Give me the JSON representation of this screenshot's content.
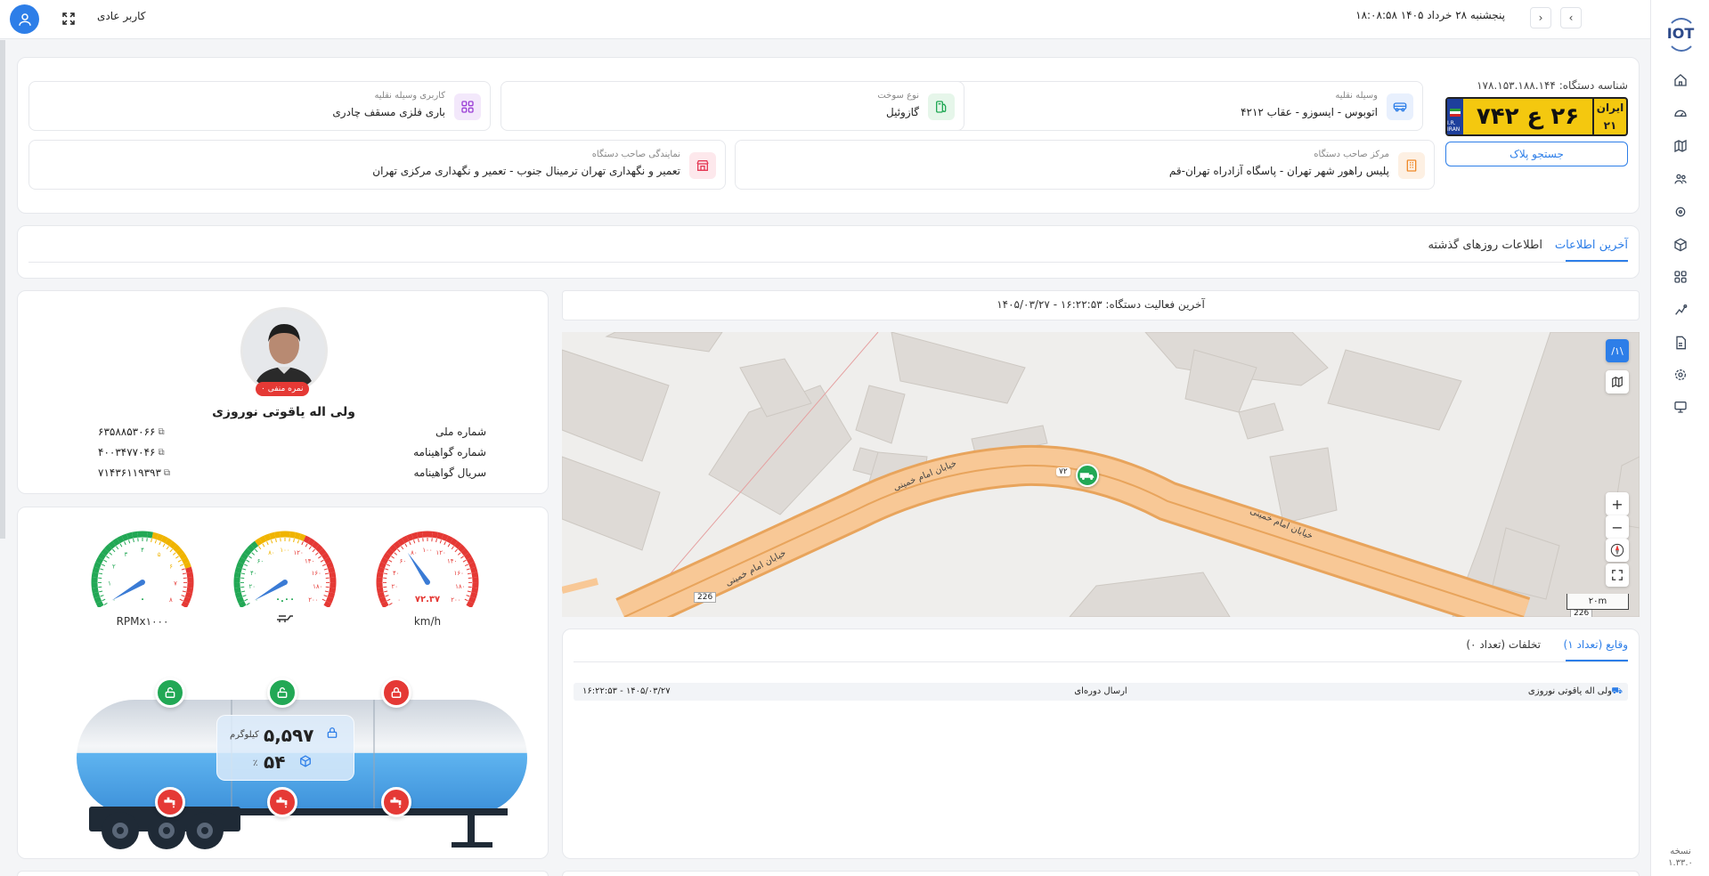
{
  "header": {
    "user_role": "کاربر عادی",
    "datetime": "پنجشنبه ۲۸ خرداد ۱۴۰۵ ۱۸:۰۸:۵۸",
    "prev_label": "‹",
    "next_label": "›"
  },
  "sidebar": {
    "logo": "IOT",
    "items": [
      "home",
      "dashboard",
      "map",
      "users",
      "location",
      "package",
      "apps",
      "routes",
      "reports",
      "settings",
      "monitor"
    ],
    "version_label": "نسخه",
    "version": "۱.۳۳.۰"
  },
  "device": {
    "id_label": "شناسه دستگاه:",
    "id_value": "۱۷۸.۱۵۳.۱۸۸.۱۴۴",
    "plate": {
      "main": "۲۶ ع ۷۴۲",
      "region_label": "ایران",
      "region_code": "۲۱",
      "flag_text": "I.R. IRAN"
    },
    "plate_search": "جستجو پلاک",
    "vehicle_label": "وسیله نقلیه",
    "vehicle_value": "اتوبوس - ایسوزو - عقاب ۴۲۱۲",
    "fuel_label": "نوع سوخت",
    "fuel_value": "گازوئیل",
    "usage_label": "کاربری وسیله نقلیه",
    "usage_value": "باری فلزی مسقف چادری",
    "center_label": "مرکز صاحب دستگاه",
    "center_value": "پلیس راهور شهر تهران - پاسگاه آزادراه تهران-قم",
    "agent_label": "نمایندگی صاحب دستگاه",
    "agent_value": "تعمیر و نگهداری تهران ترمینال جنوب - تعمیر و نگهداری مرکزی تهران"
  },
  "tabs": {
    "latest": "آخرین اطلاعات",
    "history": "اطلاعات روزهای گذشته"
  },
  "driver": {
    "negative_badge": "نمره منفی ۰",
    "name": "ولی اله یاقوتی نوروزی",
    "national_id_label": "شماره ملی",
    "national_id": "۶۳۵۸۸۵۳۰۶۶",
    "license_label": "شماره گواهینامه",
    "license": "۴۰۰۳۴۷۷۰۴۶",
    "serial_label": "سریال گواهینامه",
    "serial": "۷۱۴۳۶۱۱۹۳۹۳"
  },
  "gauges": {
    "speed_value": "۷۲.۳۷",
    "speed_unit": "km/h",
    "speed_ticks": [
      "۰",
      "۲۰",
      "۴۰",
      "۶۰",
      "۸۰",
      "۱۰۰",
      "۱۲۰",
      "۱۴۰",
      "۱۶۰",
      "۱۸۰",
      "۲۰۰"
    ],
    "fuel_value": "۰.۰۰",
    "fuel_ticks": [
      "۰",
      "۲۰",
      "۴۰",
      "۶۰",
      "۸۰",
      "۱۰۰",
      "۱۲۰",
      "۱۴۰",
      "۱۶۰",
      "۱۸۰",
      "۲۰۰"
    ],
    "rpm_value": "۰",
    "rpm_unit": "RPMx۱۰۰۰",
    "rpm_ticks": [
      "۰",
      "۱",
      "۲",
      "۳",
      "۴",
      "۵",
      "۶",
      "۷",
      "۸"
    ],
    "speed_level": 0.36,
    "fuel_level": 0.0,
    "rpm_level": 0.0
  },
  "tank": {
    "weight": "۵,۵۹۷",
    "weight_unit": "کیلوگرم",
    "percent": "۵۴",
    "percent_unit": "٪",
    "fill_level": 0.54,
    "lock_states": [
      "unlocked",
      "unlocked",
      "locked"
    ],
    "valve_states": [
      "open",
      "open",
      "open"
    ]
  },
  "activity": {
    "text": "آخرین فعالیت دستگاه: ۱۶:۲۲:۵۳ - ۱۴۰۵/۰۳/۲۷"
  },
  "map": {
    "street_name_1": "خیابان امام خمینی",
    "street_name_2": "خیابان امام خمینی",
    "street_name_3": "خیابان امام خمینی",
    "road_number": "226",
    "vehicle_speed_tag": "۷۲",
    "zoom_in": "+",
    "zoom_out": "−",
    "scale": "۲۰m",
    "layer_label": "/۱\\"
  },
  "events": {
    "tab_events": "وقایع (تعداد ۱)",
    "tab_violations": "تخلفات (تعداد ۰)",
    "rows": [
      {
        "driver": "ولی اله یاقوتی نوروزی",
        "type": "ارسال دوره‌ای",
        "time": "۱۴۰۵/۰۳/۲۷ - ۱۶:۲۲:۵۳"
      }
    ]
  },
  "colors": {
    "accent": "#2d7ee8",
    "plate_yellow": "#f4c80f",
    "danger": "#e53935",
    "success": "#22a855",
    "road": "#f8c896"
  }
}
